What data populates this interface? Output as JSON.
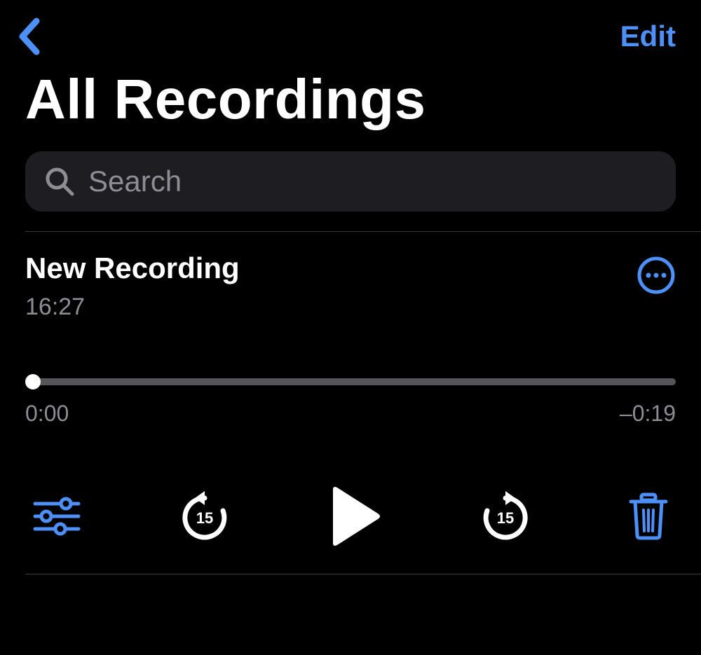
{
  "header": {
    "edit_label": "Edit",
    "title": "All Recordings"
  },
  "search": {
    "placeholder": "Search"
  },
  "recording": {
    "title": "New Recording",
    "recorded_at": "16:27",
    "elapsed": "0:00",
    "remaining": "–0:19",
    "skip_seconds": "15"
  },
  "colors": {
    "accent": "#4d90f8"
  }
}
